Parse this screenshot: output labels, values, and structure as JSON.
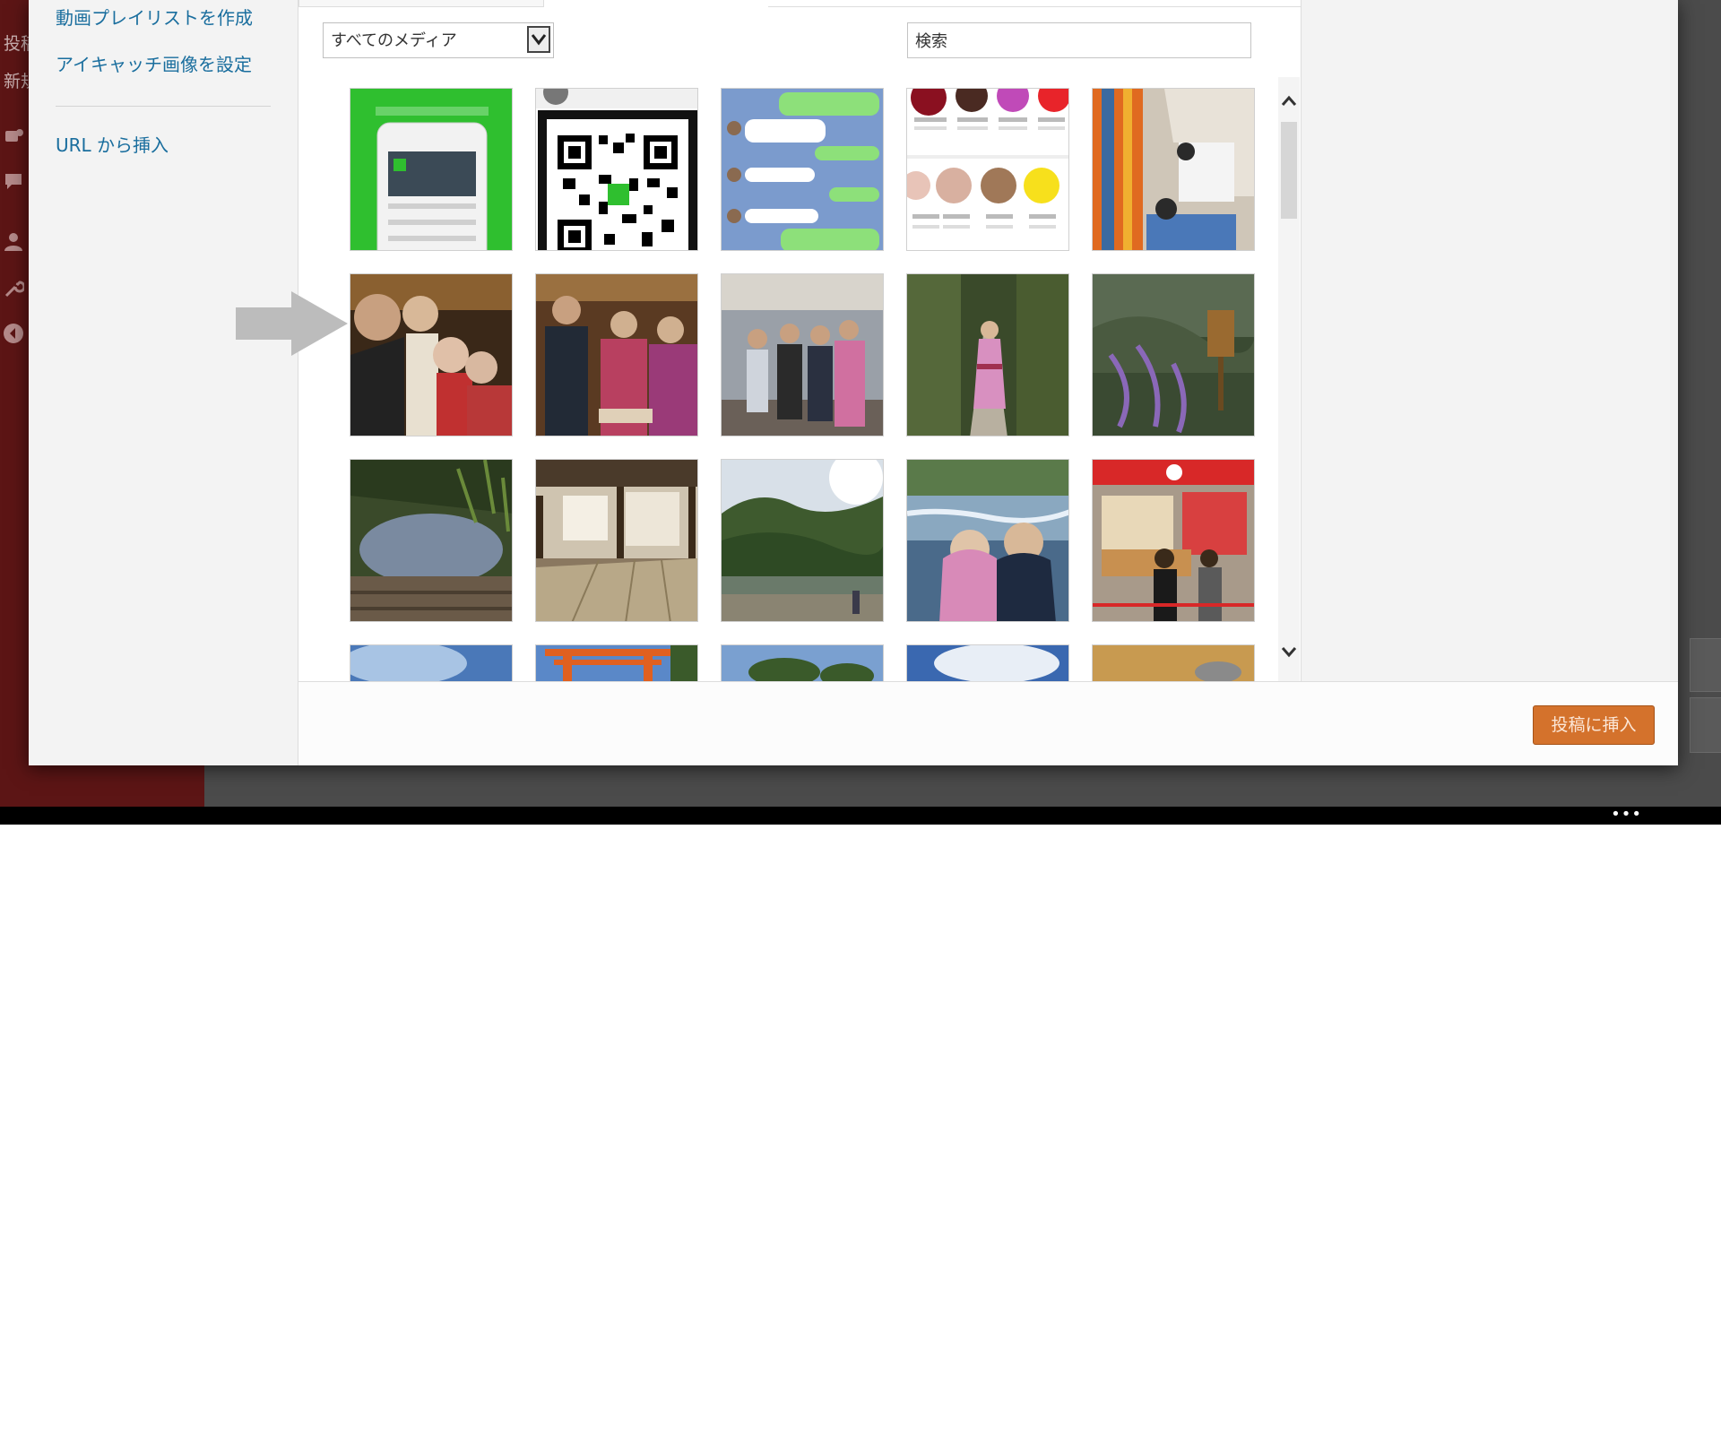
{
  "admin_sidebar": {
    "menu_posts": "投稿",
    "menu_new": "新規"
  },
  "modal": {
    "menu": {
      "create_video_playlist": "動画プレイリストを作成",
      "set_featured_image": "アイキャッチ画像を設定",
      "insert_from_url": "URL から挿入"
    },
    "filter": {
      "selected": "すべてのメディア"
    },
    "search": {
      "value": "検索"
    },
    "insert_button": "投稿に挿入"
  },
  "colors": {
    "admin_sidebar": "#5c1515",
    "link": "#1a6e9e",
    "primary_button": "#d4722c"
  }
}
